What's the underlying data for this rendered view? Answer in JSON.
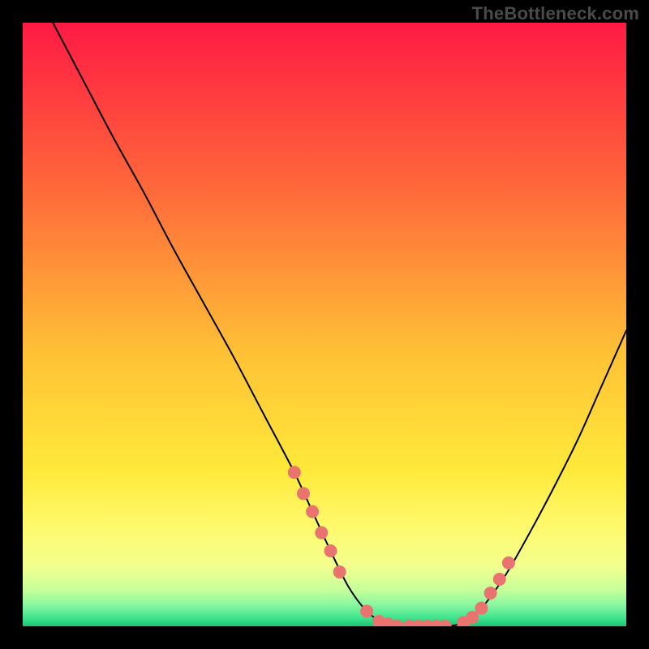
{
  "watermark": {
    "text": "TheBottleneck.com"
  },
  "chart_data": {
    "type": "line",
    "title": "",
    "xlabel": "",
    "ylabel": "",
    "xlim": [
      0,
      100
    ],
    "ylim": [
      0,
      100
    ],
    "grid": false,
    "legend": false,
    "background_gradient": {
      "stops": [
        {
          "offset": 0.0,
          "color": "#ff1a44"
        },
        {
          "offset": 0.28,
          "color": "#ff6a3a"
        },
        {
          "offset": 0.55,
          "color": "#ffc236"
        },
        {
          "offset": 0.74,
          "color": "#ffe93a"
        },
        {
          "offset": 0.83,
          "color": "#fff96a"
        },
        {
          "offset": 0.9,
          "color": "#f3ff8e"
        },
        {
          "offset": 0.94,
          "color": "#c6ff9a"
        },
        {
          "offset": 0.965,
          "color": "#88f7a0"
        },
        {
          "offset": 0.985,
          "color": "#43e58f"
        },
        {
          "offset": 1.0,
          "color": "#19c574"
        }
      ]
    },
    "series": [
      {
        "name": "bottleneck-curve",
        "color": "#000000",
        "stroke_width": 2,
        "x": [
          5,
          10,
          15,
          20,
          25,
          30,
          35,
          40,
          45,
          48,
          51,
          54,
          57,
          60,
          62,
          64,
          67,
          70,
          73,
          76,
          80,
          84,
          88,
          92,
          96,
          100
        ],
        "y": [
          100,
          90.5,
          81,
          72,
          62.5,
          53.5,
          44.5,
          35,
          25.5,
          19,
          12.5,
          6.5,
          2.5,
          0.4,
          0,
          0,
          0,
          0,
          0.6,
          3,
          8.5,
          15.5,
          23,
          31,
          40,
          49
        ]
      }
    ],
    "markers": {
      "name": "highlight-dots",
      "color": "#e9746f",
      "radius": 8,
      "x": [
        45,
        46.5,
        48,
        49.5,
        51,
        52.5,
        57,
        59,
        60.5,
        62,
        64,
        65.5,
        67,
        68.5,
        70,
        73,
        74.5,
        76,
        77.5,
        79,
        80.5
      ],
      "y": [
        25.5,
        22,
        19,
        15.5,
        12.5,
        9,
        2.5,
        0.8,
        0.4,
        0,
        0,
        0,
        0,
        0,
        0,
        0.6,
        1.5,
        3,
        5.5,
        7.8,
        10.5
      ]
    }
  }
}
